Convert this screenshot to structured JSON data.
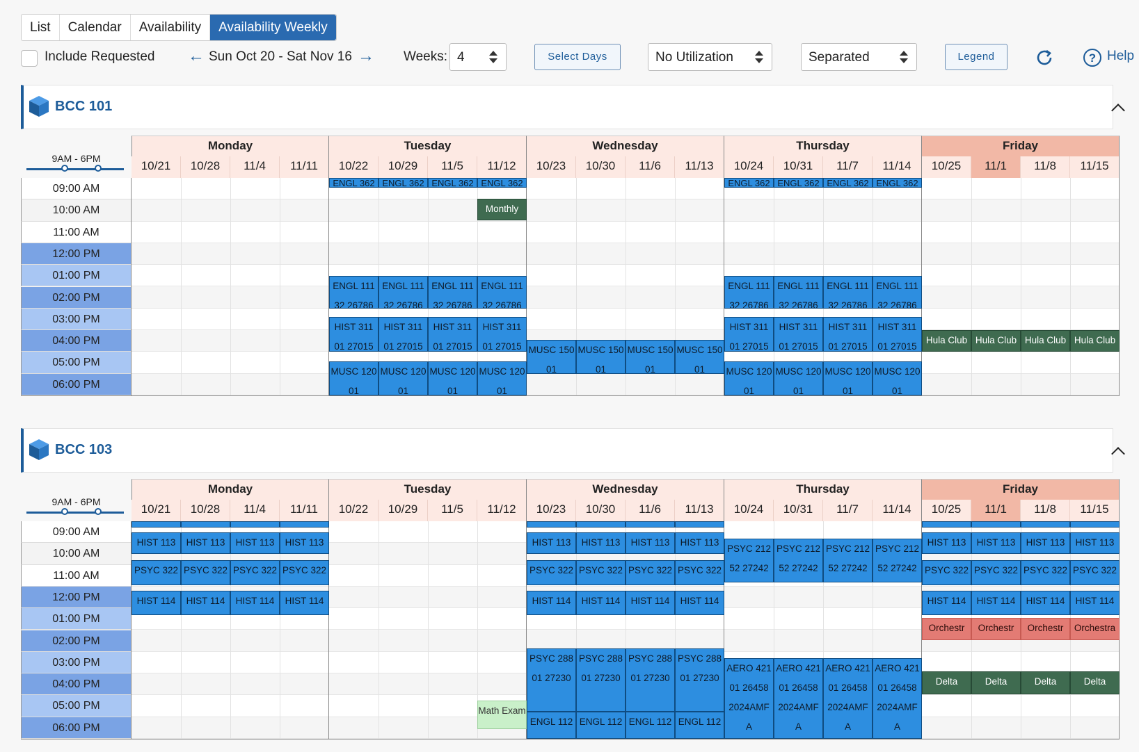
{
  "tabs": [
    "List",
    "Calendar",
    "Availability",
    "Availability Weekly"
  ],
  "toolbar": {
    "include_requested": "Include Requested",
    "date_range": "Sun Oct 20 - Sat Nov 16",
    "weeks_label": "Weeks:",
    "weeks_value": "4",
    "select_days": "Select Days",
    "utilization": "No Utilization",
    "view_mode": "Separated",
    "legend": "Legend",
    "help": "Help"
  },
  "time_range": "9AM - 6PM",
  "times": [
    "09:00 AM",
    "10:00 AM",
    "11:00 AM",
    "12:00 PM",
    "01:00 PM",
    "02:00 PM",
    "03:00 PM",
    "04:00 PM",
    "05:00 PM",
    "06:00 PM"
  ],
  "days": [
    {
      "name": "Monday",
      "dates": [
        "10/21",
        "10/28",
        "11/4",
        "11/11"
      ]
    },
    {
      "name": "Tuesday",
      "dates": [
        "10/22",
        "10/29",
        "11/5",
        "11/12"
      ]
    },
    {
      "name": "Wednesday",
      "dates": [
        "10/23",
        "10/30",
        "11/6",
        "11/13"
      ]
    },
    {
      "name": "Thursday",
      "dates": [
        "10/24",
        "10/31",
        "11/7",
        "11/14"
      ]
    },
    {
      "name": "Friday",
      "dates": [
        "10/25",
        "11/1",
        "11/8",
        "11/15"
      ]
    }
  ],
  "rooms": [
    {
      "name": "BCC 101",
      "events": [
        {
          "col": 4,
          "start": 0,
          "end": 0.45,
          "label": "ENGL 362",
          "type": "blue"
        },
        {
          "col": 5,
          "start": 0,
          "end": 0.45,
          "label": "ENGL 362",
          "type": "blue"
        },
        {
          "col": 6,
          "start": 0,
          "end": 0.45,
          "label": "ENGL 362",
          "type": "blue"
        },
        {
          "col": 7,
          "start": 0,
          "end": 0.45,
          "label": "ENGL 362",
          "type": "blue"
        },
        {
          "col": 12,
          "start": 0,
          "end": 0.45,
          "label": "ENGL 362",
          "type": "blue"
        },
        {
          "col": 13,
          "start": 0,
          "end": 0.45,
          "label": "ENGL 362",
          "type": "blue"
        },
        {
          "col": 14,
          "start": 0,
          "end": 0.45,
          "label": "ENGL 362",
          "type": "blue"
        },
        {
          "col": 15,
          "start": 0,
          "end": 0.45,
          "label": "ENGL 362",
          "type": "blue"
        },
        {
          "col": 7,
          "start": 0.95,
          "end": 1.95,
          "label": "Monthly",
          "type": "green"
        },
        {
          "col": 4,
          "start": 4.5,
          "end": 6.0,
          "label": "ENGL 111 32 26786",
          "type": "blue"
        },
        {
          "col": 5,
          "start": 4.5,
          "end": 6.0,
          "label": "ENGL 111 32 26786",
          "type": "blue"
        },
        {
          "col": 6,
          "start": 4.5,
          "end": 6.0,
          "label": "ENGL 111 32 26786",
          "type": "blue"
        },
        {
          "col": 7,
          "start": 4.5,
          "end": 6.0,
          "label": "ENGL 111 32 26786",
          "type": "blue"
        },
        {
          "col": 12,
          "start": 4.5,
          "end": 6.0,
          "label": "ENGL 111 32 26786",
          "type": "blue"
        },
        {
          "col": 13,
          "start": 4.5,
          "end": 6.0,
          "label": "ENGL 111 32 26786",
          "type": "blue"
        },
        {
          "col": 14,
          "start": 4.5,
          "end": 6.0,
          "label": "ENGL 111 32 26786",
          "type": "blue"
        },
        {
          "col": 15,
          "start": 4.5,
          "end": 6.0,
          "label": "ENGL 111 32 26786",
          "type": "blue"
        },
        {
          "col": 4,
          "start": 6.4,
          "end": 8.0,
          "label": "HIST 311 01 27015",
          "type": "blue"
        },
        {
          "col": 5,
          "start": 6.4,
          "end": 8.0,
          "label": "HIST 311 01 27015",
          "type": "blue"
        },
        {
          "col": 6,
          "start": 6.4,
          "end": 8.0,
          "label": "HIST 311 01 27015",
          "type": "blue"
        },
        {
          "col": 7,
          "start": 6.4,
          "end": 8.0,
          "label": "HIST 311 01 27015",
          "type": "blue"
        },
        {
          "col": 12,
          "start": 6.4,
          "end": 8.0,
          "label": "HIST 311 01 27015",
          "type": "blue"
        },
        {
          "col": 13,
          "start": 6.4,
          "end": 8.0,
          "label": "HIST 311 01 27015",
          "type": "blue"
        },
        {
          "col": 14,
          "start": 6.4,
          "end": 8.0,
          "label": "HIST 311 01 27015",
          "type": "blue"
        },
        {
          "col": 15,
          "start": 6.4,
          "end": 8.0,
          "label": "HIST 311 01 27015",
          "type": "blue"
        },
        {
          "col": 8,
          "start": 7.45,
          "end": 9.0,
          "label": "MUSC 150 01",
          "type": "blue"
        },
        {
          "col": 9,
          "start": 7.45,
          "end": 9.0,
          "label": "MUSC 150 01",
          "type": "blue"
        },
        {
          "col": 10,
          "start": 7.45,
          "end": 9.0,
          "label": "MUSC 150 01",
          "type": "blue"
        },
        {
          "col": 11,
          "start": 7.45,
          "end": 9.0,
          "label": "MUSC 150 01",
          "type": "blue"
        },
        {
          "col": 4,
          "start": 8.45,
          "end": 10,
          "label": "MUSC 120 01",
          "type": "blue"
        },
        {
          "col": 5,
          "start": 8.45,
          "end": 10,
          "label": "MUSC 120 01",
          "type": "blue"
        },
        {
          "col": 6,
          "start": 8.45,
          "end": 10,
          "label": "MUSC 120 01",
          "type": "blue"
        },
        {
          "col": 7,
          "start": 8.45,
          "end": 10,
          "label": "MUSC 120 01",
          "type": "blue"
        },
        {
          "col": 12,
          "start": 8.45,
          "end": 10,
          "label": "MUSC 120 01",
          "type": "blue"
        },
        {
          "col": 13,
          "start": 8.45,
          "end": 10,
          "label": "MUSC 120 01",
          "type": "blue"
        },
        {
          "col": 14,
          "start": 8.45,
          "end": 10,
          "label": "MUSC 120 01",
          "type": "blue"
        },
        {
          "col": 15,
          "start": 8.45,
          "end": 10,
          "label": "MUSC 120 01",
          "type": "blue"
        },
        {
          "col": 16,
          "start": 7.0,
          "end": 8.0,
          "label": "Hula Club",
          "type": "green"
        },
        {
          "col": 17,
          "start": 7.0,
          "end": 8.0,
          "label": "Hula Club",
          "type": "green"
        },
        {
          "col": 18,
          "start": 7.0,
          "end": 8.0,
          "label": "Hula Club",
          "type": "green"
        },
        {
          "col": 19,
          "start": 7.0,
          "end": 8.0,
          "label": "Hula Club",
          "type": "green"
        }
      ]
    },
    {
      "name": "BCC 103",
      "events": [
        {
          "col": 0,
          "start": 0,
          "end": 0.3,
          "label": "",
          "type": "blue"
        },
        {
          "col": 1,
          "start": 0,
          "end": 0.3,
          "label": "",
          "type": "blue"
        },
        {
          "col": 2,
          "start": 0,
          "end": 0.3,
          "label": "",
          "type": "blue"
        },
        {
          "col": 3,
          "start": 0,
          "end": 0.3,
          "label": "",
          "type": "blue"
        },
        {
          "col": 8,
          "start": 0,
          "end": 0.3,
          "label": "",
          "type": "blue"
        },
        {
          "col": 9,
          "start": 0,
          "end": 0.3,
          "label": "",
          "type": "blue"
        },
        {
          "col": 10,
          "start": 0,
          "end": 0.3,
          "label": "",
          "type": "blue"
        },
        {
          "col": 11,
          "start": 0,
          "end": 0.3,
          "label": "",
          "type": "blue"
        },
        {
          "col": 16,
          "start": 0,
          "end": 0.3,
          "label": "",
          "type": "blue"
        },
        {
          "col": 17,
          "start": 0,
          "end": 0.3,
          "label": "",
          "type": "blue"
        },
        {
          "col": 18,
          "start": 0,
          "end": 0.3,
          "label": "",
          "type": "blue"
        },
        {
          "col": 19,
          "start": 0,
          "end": 0.3,
          "label": "",
          "type": "blue"
        },
        {
          "col": 0,
          "start": 0.5,
          "end": 1.5,
          "label": "HIST 113",
          "type": "blue"
        },
        {
          "col": 1,
          "start": 0.5,
          "end": 1.5,
          "label": "HIST 113",
          "type": "blue"
        },
        {
          "col": 2,
          "start": 0.5,
          "end": 1.5,
          "label": "HIST 113",
          "type": "blue"
        },
        {
          "col": 3,
          "start": 0.5,
          "end": 1.5,
          "label": "HIST 113",
          "type": "blue"
        },
        {
          "col": 8,
          "start": 0.5,
          "end": 1.5,
          "label": "HIST 113",
          "type": "blue"
        },
        {
          "col": 9,
          "start": 0.5,
          "end": 1.5,
          "label": "HIST 113",
          "type": "blue"
        },
        {
          "col": 10,
          "start": 0.5,
          "end": 1.5,
          "label": "HIST 113",
          "type": "blue"
        },
        {
          "col": 11,
          "start": 0.5,
          "end": 1.5,
          "label": "HIST 113",
          "type": "blue"
        },
        {
          "col": 16,
          "start": 0.5,
          "end": 1.5,
          "label": "HIST 113",
          "type": "blue"
        },
        {
          "col": 17,
          "start": 0.5,
          "end": 1.5,
          "label": "HIST 113",
          "type": "blue"
        },
        {
          "col": 18,
          "start": 0.5,
          "end": 1.5,
          "label": "HIST 113",
          "type": "blue"
        },
        {
          "col": 19,
          "start": 0.5,
          "end": 1.5,
          "label": "HIST 113",
          "type": "blue"
        },
        {
          "col": 0,
          "start": 1.8,
          "end": 2.95,
          "label": "PSYC 322",
          "type": "blue"
        },
        {
          "col": 1,
          "start": 1.8,
          "end": 2.95,
          "label": "PSYC 322",
          "type": "blue"
        },
        {
          "col": 2,
          "start": 1.8,
          "end": 2.95,
          "label": "PSYC 322",
          "type": "blue"
        },
        {
          "col": 3,
          "start": 1.8,
          "end": 2.95,
          "label": "PSYC 322",
          "type": "blue"
        },
        {
          "col": 8,
          "start": 1.8,
          "end": 2.95,
          "label": "PSYC 322",
          "type": "blue"
        },
        {
          "col": 9,
          "start": 1.8,
          "end": 2.95,
          "label": "PSYC 322",
          "type": "blue"
        },
        {
          "col": 10,
          "start": 1.8,
          "end": 2.95,
          "label": "PSYC 322",
          "type": "blue"
        },
        {
          "col": 11,
          "start": 1.8,
          "end": 2.95,
          "label": "PSYC 322",
          "type": "blue"
        },
        {
          "col": 16,
          "start": 1.8,
          "end": 2.95,
          "label": "PSYC 322",
          "type": "blue"
        },
        {
          "col": 17,
          "start": 1.8,
          "end": 2.95,
          "label": "PSYC 322",
          "type": "blue"
        },
        {
          "col": 18,
          "start": 1.8,
          "end": 2.95,
          "label": "PSYC 322",
          "type": "blue"
        },
        {
          "col": 19,
          "start": 1.8,
          "end": 2.95,
          "label": "PSYC 322",
          "type": "blue"
        },
        {
          "col": 12,
          "start": 0.8,
          "end": 2.8,
          "label": "PSYC 212 52 27242",
          "type": "blue"
        },
        {
          "col": 13,
          "start": 0.8,
          "end": 2.8,
          "label": "PSYC 212 52 27242",
          "type": "blue"
        },
        {
          "col": 14,
          "start": 0.8,
          "end": 2.8,
          "label": "PSYC 212 52 27242",
          "type": "blue"
        },
        {
          "col": 15,
          "start": 0.8,
          "end": 2.8,
          "label": "PSYC 212 52 27242",
          "type": "blue"
        },
        {
          "col": 0,
          "start": 3.2,
          "end": 4.3,
          "label": "HIST 114",
          "type": "blue"
        },
        {
          "col": 1,
          "start": 3.2,
          "end": 4.3,
          "label": "HIST 114",
          "type": "blue"
        },
        {
          "col": 2,
          "start": 3.2,
          "end": 4.3,
          "label": "HIST 114",
          "type": "blue"
        },
        {
          "col": 3,
          "start": 3.2,
          "end": 4.3,
          "label": "HIST 114",
          "type": "blue"
        },
        {
          "col": 8,
          "start": 3.2,
          "end": 4.3,
          "label": "HIST 114",
          "type": "blue"
        },
        {
          "col": 9,
          "start": 3.2,
          "end": 4.3,
          "label": "HIST 114",
          "type": "blue"
        },
        {
          "col": 10,
          "start": 3.2,
          "end": 4.3,
          "label": "HIST 114",
          "type": "blue"
        },
        {
          "col": 11,
          "start": 3.2,
          "end": 4.3,
          "label": "HIST 114",
          "type": "blue"
        },
        {
          "col": 16,
          "start": 3.2,
          "end": 4.3,
          "label": "HIST 114",
          "type": "blue"
        },
        {
          "col": 17,
          "start": 3.2,
          "end": 4.3,
          "label": "HIST 114",
          "type": "blue"
        },
        {
          "col": 18,
          "start": 3.2,
          "end": 4.3,
          "label": "HIST 114",
          "type": "blue"
        },
        {
          "col": 19,
          "start": 3.2,
          "end": 4.3,
          "label": "HIST 114",
          "type": "blue"
        },
        {
          "col": 16,
          "start": 4.45,
          "end": 5.45,
          "label": "Orchestr",
          "type": "red"
        },
        {
          "col": 17,
          "start": 4.45,
          "end": 5.45,
          "label": "Orchestr",
          "type": "red"
        },
        {
          "col": 18,
          "start": 4.45,
          "end": 5.45,
          "label": "Orchestr",
          "type": "red"
        },
        {
          "col": 19,
          "start": 4.45,
          "end": 5.45,
          "label": "Orchestra",
          "type": "red"
        },
        {
          "col": 8,
          "start": 5.85,
          "end": 8.75,
          "label": "PSYC 288 01 27230",
          "type": "blue"
        },
        {
          "col": 9,
          "start": 5.85,
          "end": 8.75,
          "label": "PSYC 288 01 27230",
          "type": "blue"
        },
        {
          "col": 10,
          "start": 5.85,
          "end": 8.75,
          "label": "PSYC 288 01 27230",
          "type": "blue"
        },
        {
          "col": 11,
          "start": 5.85,
          "end": 8.75,
          "label": "PSYC 288 01 27230",
          "type": "blue"
        },
        {
          "col": 8,
          "start": 8.75,
          "end": 10,
          "label": "ENGL 112",
          "type": "blue"
        },
        {
          "col": 9,
          "start": 8.75,
          "end": 10,
          "label": "ENGL 112",
          "type": "blue"
        },
        {
          "col": 10,
          "start": 8.75,
          "end": 10,
          "label": "ENGL 112",
          "type": "blue"
        },
        {
          "col": 11,
          "start": 8.75,
          "end": 10,
          "label": "ENGL 112",
          "type": "blue"
        },
        {
          "col": 12,
          "start": 6.3,
          "end": 10,
          "label": "AERO 421 01 26458 2024AMF A",
          "type": "blue"
        },
        {
          "col": 13,
          "start": 6.3,
          "end": 10,
          "label": "AERO 421 01 26458 2024AMF A",
          "type": "blue"
        },
        {
          "col": 14,
          "start": 6.3,
          "end": 10,
          "label": "AERO 421 01 26458 2024AMF A",
          "type": "blue"
        },
        {
          "col": 15,
          "start": 6.3,
          "end": 10,
          "label": "AERO 421 01 26458 2024AMF A",
          "type": "blue"
        },
        {
          "col": 16,
          "start": 6.9,
          "end": 7.95,
          "label": "Delta",
          "type": "green"
        },
        {
          "col": 17,
          "start": 6.9,
          "end": 7.95,
          "label": "Delta",
          "type": "green"
        },
        {
          "col": 18,
          "start": 6.9,
          "end": 7.95,
          "label": "Delta",
          "type": "green"
        },
        {
          "col": 19,
          "start": 6.9,
          "end": 7.95,
          "label": "Delta",
          "type": "green"
        },
        {
          "col": 7,
          "start": 8.25,
          "end": 9.55,
          "label": "Math Exam",
          "type": "light"
        }
      ]
    }
  ],
  "colors": {
    "accent": "#2a6ab0",
    "event_blue": "#2d8ee0",
    "event_green": "#3f6b50",
    "event_red": "#e37b74",
    "header_peach": "#fde9e3",
    "friday_header": "#f2b8a6",
    "time_blue": "#7aa3e4",
    "time_blue_alt": "#a8c6f3"
  }
}
